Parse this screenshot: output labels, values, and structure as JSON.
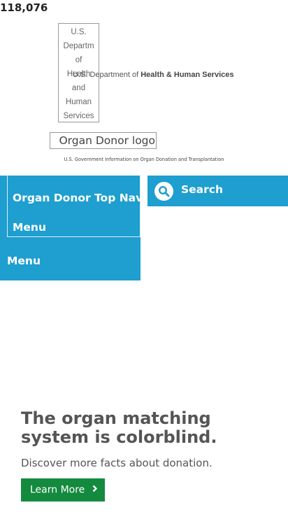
{
  "counter": "118,076",
  "header": {
    "hhs_logo_alt_lines": [
      "U.S.",
      "Departm",
      "of",
      "Health",
      "and",
      "Human",
      "Services"
    ],
    "hhs_prefix": "U.S. Department of",
    "hhs_bold": "Health & Human Services",
    "organ_donor_logo_alt": "Organ Donor logo",
    "gov_tagline": "U.S. Government Information on Organ Donation and Transplantation"
  },
  "nav": {
    "title_line1": "Organ Donor Top Nav",
    "title_line2": "Menu",
    "menu_label": "Menu"
  },
  "search": {
    "label": "Search",
    "icon": "search-icon"
  },
  "hero": {
    "title": "The organ matching system is colorblind.",
    "subtitle": "Discover more facts about donation.",
    "button_label": "Learn More",
    "button_icon": "chevron-right-icon"
  },
  "colors": {
    "nav_blue": "#1e9fcf",
    "button_green": "#138a3e",
    "heading_gray": "#555555"
  }
}
